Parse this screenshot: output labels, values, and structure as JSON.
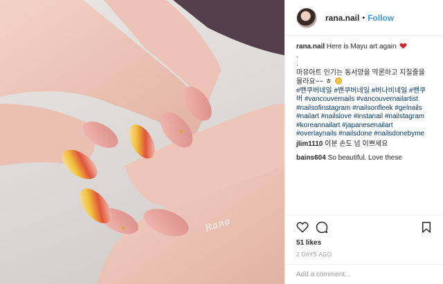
{
  "post": {
    "author": "rana.nail",
    "separator": "•",
    "follow_label": "Follow",
    "watermark": "Rana"
  },
  "caption": {
    "username": "rana.nail",
    "text": "Here is Mayu art again",
    "dot1": ".",
    "dot2": ".",
    "korean": "마유아트 인기는 동서양을 막론하고 지칠줄을 몰라요~~ ㅎ",
    "hashtags": "#밴쿠버네일 #밴쿠버네일 #버나비네일 #밴쿠버 #vancouvernails #vancouvernailartist #nailsofinstagram #nailsonfleek #gelnails #nailart #nailslove #instanail #nailstagram #koreannailart #japanesenailart #overlaynails #nailsdone #nailsdonebyme"
  },
  "comments": [
    {
      "user": "jlim1110",
      "text": "이분 손도 넘 이쁘세요"
    },
    {
      "user": "bains604",
      "text": "So beautiful. Love these"
    }
  ],
  "icons": [
    "heart-icon",
    "comment-icon",
    "save-icon",
    "heart-emoji-icon",
    "grin-emoji-icon"
  ],
  "stats": {
    "likes": "51 likes",
    "time_ago": "2 DAYS AGO"
  },
  "add_comment": {
    "placeholder": "Add a comment..."
  },
  "colors": {
    "link": "#3897f0",
    "hashtag": "#003569",
    "muted": "#999999",
    "text": "#262626"
  }
}
